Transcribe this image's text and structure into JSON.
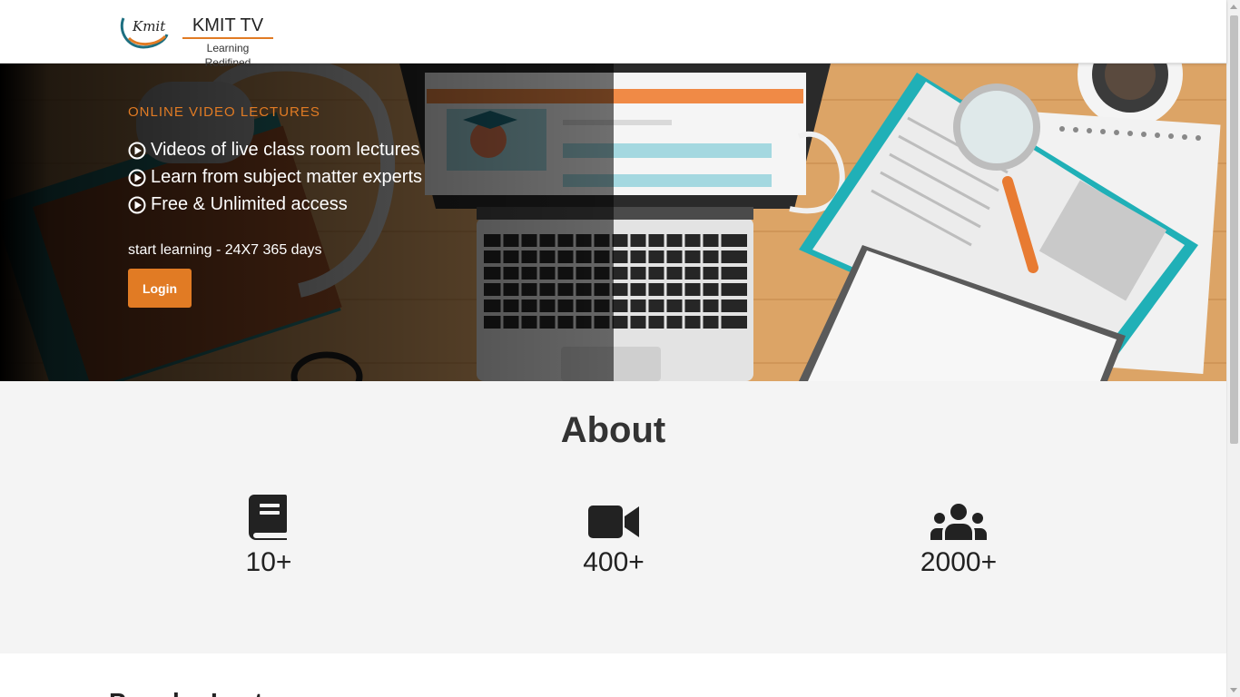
{
  "header": {
    "logo_text": "Kmit",
    "title": "KMIT TV",
    "tagline": "Learning Redifined"
  },
  "hero": {
    "kicker": "ONLINE VIDEO LECTURES",
    "features": [
      "Videos of live class room lectures",
      "Learn from subject matter experts",
      "Free & Unlimited access"
    ],
    "subtext": "start learning - 24X7 365 days",
    "login_label": "Login",
    "feature_icon": "play-circle-icon"
  },
  "about": {
    "title": "About",
    "stats": [
      {
        "icon": "book-icon",
        "value": "10+"
      },
      {
        "icon": "video-camera-icon",
        "value": "400+"
      },
      {
        "icon": "users-icon",
        "value": "2000+"
      }
    ]
  },
  "lower": {
    "heading": "Popular Lectures"
  },
  "colors": {
    "accent": "#e17b24",
    "about_bg": "#f4f4f4",
    "text_dark": "#222222"
  }
}
